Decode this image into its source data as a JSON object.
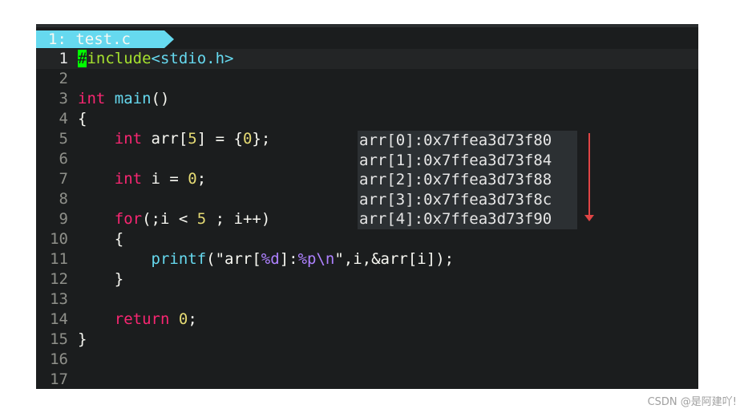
{
  "tab": {
    "label": "1: test.c"
  },
  "code_lines": [
    {
      "n": "1",
      "parts": [
        {
          "t": "#",
          "c": "cursor"
        },
        {
          "t": "include",
          "c": "str"
        },
        {
          "t": "<stdio.h>",
          "c": "inc"
        }
      ]
    },
    {
      "n": "2",
      "parts": []
    },
    {
      "n": "3",
      "parts": [
        {
          "t": "int",
          "c": "ty"
        },
        {
          "t": " "
        },
        {
          "t": "main",
          "c": "fn"
        },
        {
          "t": "()"
        }
      ]
    },
    {
      "n": "4",
      "parts": [
        {
          "t": "{"
        }
      ]
    },
    {
      "n": "5",
      "parts": [
        {
          "t": "    "
        },
        {
          "t": "int",
          "c": "ty"
        },
        {
          "t": " arr["
        },
        {
          "t": "5",
          "c": "num"
        },
        {
          "t": "] = {"
        },
        {
          "t": "0",
          "c": "num"
        },
        {
          "t": "};"
        }
      ]
    },
    {
      "n": "6",
      "parts": []
    },
    {
      "n": "7",
      "parts": [
        {
          "t": "    "
        },
        {
          "t": "int",
          "c": "ty"
        },
        {
          "t": " i = "
        },
        {
          "t": "0",
          "c": "num"
        },
        {
          "t": ";"
        }
      ]
    },
    {
      "n": "8",
      "parts": []
    },
    {
      "n": "9",
      "parts": [
        {
          "t": "    "
        },
        {
          "t": "for",
          "c": "kw"
        },
        {
          "t": "(;i < "
        },
        {
          "t": "5",
          "c": "num"
        },
        {
          "t": " ; i++)"
        }
      ]
    },
    {
      "n": "10",
      "parts": [
        {
          "t": "    {"
        }
      ]
    },
    {
      "n": "11",
      "parts": [
        {
          "t": "        "
        },
        {
          "t": "printf",
          "c": "fn"
        },
        {
          "t": "(\"arr["
        },
        {
          "t": "%d",
          "c": "esc"
        },
        {
          "t": "]:"
        },
        {
          "t": "%p",
          "c": "esc"
        },
        {
          "t": "\\n",
          "c": "esc"
        },
        {
          "t": "\",i,&arr[i]);"
        }
      ]
    },
    {
      "n": "12",
      "parts": [
        {
          "t": "    }"
        }
      ]
    },
    {
      "n": "13",
      "parts": []
    },
    {
      "n": "14",
      "parts": [
        {
          "t": "    "
        },
        {
          "t": "return",
          "c": "kw"
        },
        {
          "t": " "
        },
        {
          "t": "0",
          "c": "num"
        },
        {
          "t": ";"
        }
      ]
    },
    {
      "n": "15",
      "parts": [
        {
          "t": "}"
        }
      ]
    },
    {
      "n": "16",
      "parts": []
    },
    {
      "n": "17",
      "parts": []
    }
  ],
  "output_lines": [
    "arr[0]:0x7ffea3d73f80",
    "arr[1]:0x7ffea3d73f84",
    "arr[2]:0x7ffea3d73f88",
    "arr[3]:0x7ffea3d73f8c",
    "arr[4]:0x7ffea3d73f90"
  ],
  "watermark": "CSDN @是阿建吖!",
  "colors": {
    "background": "#1b1d1e",
    "keyword": "#f92672",
    "function": "#66d9ef",
    "number": "#e6db74",
    "include_keyword": "#a6e22e",
    "format_spec": "#ae81ff",
    "cursor": "#00ff00",
    "arrow": "#e04545"
  }
}
